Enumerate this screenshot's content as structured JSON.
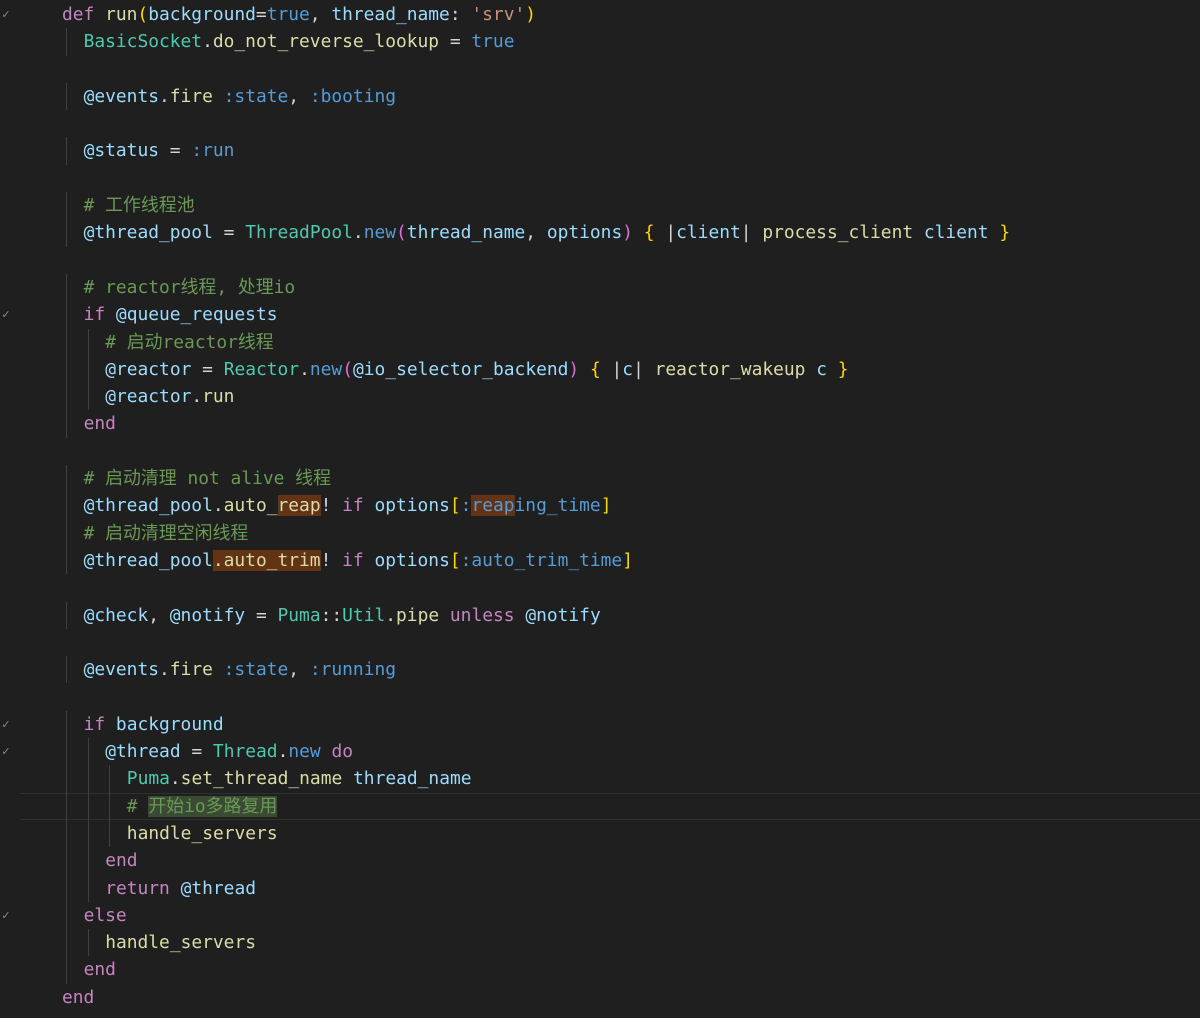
{
  "editor": {
    "gutter_markers": [
      {
        "line": 0,
        "symbol": "✓"
      },
      {
        "line": 11,
        "symbol": "✓"
      },
      {
        "line": 26,
        "symbol": "✓"
      },
      {
        "line": 27,
        "symbol": "✓"
      },
      {
        "line": 33,
        "symbol": "✓"
      }
    ],
    "current_line": 29,
    "lines": [
      {
        "indent": 0,
        "tokens": [
          [
            "def ",
            "kw"
          ],
          [
            "run",
            "fn"
          ],
          [
            "(",
            "br1"
          ],
          [
            "background",
            "var"
          ],
          [
            "=",
            "op"
          ],
          [
            "true",
            "bool"
          ],
          [
            ", ",
            "op"
          ],
          [
            "thread_name",
            "var"
          ],
          [
            ": ",
            "op"
          ],
          [
            "'srv'",
            "str"
          ],
          [
            ")",
            "br1"
          ]
        ]
      },
      {
        "indent": 1,
        "tokens": [
          [
            "BasicSocket",
            "cls"
          ],
          [
            ".",
            "op"
          ],
          [
            "do_not_reverse_lookup",
            "fn"
          ],
          [
            " = ",
            "op"
          ],
          [
            "true",
            "bool"
          ]
        ]
      },
      {
        "indent": 1,
        "tokens": []
      },
      {
        "indent": 1,
        "tokens": [
          [
            "@events",
            "ivar"
          ],
          [
            ".",
            "op"
          ],
          [
            "fire",
            "fn"
          ],
          [
            " ",
            "op"
          ],
          [
            ":state",
            "sym"
          ],
          [
            ", ",
            "op"
          ],
          [
            ":booting",
            "sym"
          ]
        ]
      },
      {
        "indent": 1,
        "tokens": []
      },
      {
        "indent": 1,
        "tokens": [
          [
            "@status",
            "ivar"
          ],
          [
            " = ",
            "op"
          ],
          [
            ":run",
            "sym"
          ]
        ]
      },
      {
        "indent": 1,
        "tokens": []
      },
      {
        "indent": 1,
        "tokens": [
          [
            "# 工作线程池",
            "cmt"
          ]
        ]
      },
      {
        "indent": 1,
        "tokens": [
          [
            "@thread_pool",
            "ivar"
          ],
          [
            " = ",
            "op"
          ],
          [
            "ThreadPool",
            "cls"
          ],
          [
            ".",
            "op"
          ],
          [
            "new",
            "bool"
          ],
          [
            "(",
            "br2"
          ],
          [
            "thread_name",
            "var"
          ],
          [
            ", ",
            "op"
          ],
          [
            "options",
            "var"
          ],
          [
            ")",
            "br2"
          ],
          [
            " ",
            "op"
          ],
          [
            "{",
            "br1"
          ],
          [
            " |",
            "op"
          ],
          [
            "client",
            "var"
          ],
          [
            "| ",
            "op"
          ],
          [
            "process_client",
            "fn"
          ],
          [
            " ",
            "op"
          ],
          [
            "client",
            "var"
          ],
          [
            " ",
            "op"
          ],
          [
            "}",
            "br1"
          ]
        ]
      },
      {
        "indent": 1,
        "tokens": []
      },
      {
        "indent": 1,
        "tokens": [
          [
            "# reactor线程, 处理io",
            "cmt"
          ]
        ]
      },
      {
        "indent": 1,
        "tokens": [
          [
            "if ",
            "kw"
          ],
          [
            "@queue_requests",
            "ivar"
          ]
        ]
      },
      {
        "indent": 2,
        "tokens": [
          [
            "# 启动reactor线程",
            "cmt"
          ]
        ]
      },
      {
        "indent": 2,
        "tokens": [
          [
            "@reactor",
            "ivar"
          ],
          [
            " = ",
            "op"
          ],
          [
            "Reactor",
            "cls"
          ],
          [
            ".",
            "op"
          ],
          [
            "new",
            "bool"
          ],
          [
            "(",
            "br2"
          ],
          [
            "@io_selector_backend",
            "ivar"
          ],
          [
            ")",
            "br2"
          ],
          [
            " ",
            "op"
          ],
          [
            "{",
            "br1"
          ],
          [
            " |",
            "op"
          ],
          [
            "c",
            "var"
          ],
          [
            "| ",
            "op"
          ],
          [
            "reactor_wakeup",
            "fn"
          ],
          [
            " ",
            "op"
          ],
          [
            "c",
            "var"
          ],
          [
            " ",
            "op"
          ],
          [
            "}",
            "br1"
          ]
        ]
      },
      {
        "indent": 2,
        "tokens": [
          [
            "@reactor",
            "ivar"
          ],
          [
            ".",
            "op"
          ],
          [
            "run",
            "fn"
          ]
        ]
      },
      {
        "indent": 1,
        "tokens": [
          [
            "end",
            "kw"
          ]
        ]
      },
      {
        "indent": 1,
        "tokens": []
      },
      {
        "indent": 1,
        "tokens": [
          [
            "# 启动清理 not alive 线程",
            "cmt"
          ]
        ]
      },
      {
        "indent": 1,
        "tokens": [
          [
            "@thread_pool",
            "ivar"
          ],
          [
            ".",
            "op"
          ],
          [
            "auto_",
            "fn"
          ],
          [
            "reap",
            "fn",
            "hl"
          ],
          [
            "! ",
            "op"
          ],
          [
            "if ",
            "kw"
          ],
          [
            "options",
            "var"
          ],
          [
            "[",
            "br1"
          ],
          [
            ":",
            "sym"
          ],
          [
            "reap",
            "sym",
            "hl"
          ],
          [
            "ing_time",
            "sym"
          ],
          [
            "]",
            "br1"
          ]
        ]
      },
      {
        "indent": 1,
        "tokens": [
          [
            "# 启动清理空闲线程",
            "cmt"
          ]
        ]
      },
      {
        "indent": 1,
        "tokens": [
          [
            "@thread_pool",
            "ivar"
          ],
          [
            ".auto_trim",
            "fn",
            "hl"
          ],
          [
            "! ",
            "op"
          ],
          [
            "if ",
            "kw"
          ],
          [
            "options",
            "var"
          ],
          [
            "[",
            "br1"
          ],
          [
            ":auto_trim_time",
            "sym"
          ],
          [
            "]",
            "br1"
          ]
        ]
      },
      {
        "indent": 1,
        "tokens": []
      },
      {
        "indent": 1,
        "tokens": [
          [
            "@check",
            "ivar"
          ],
          [
            ", ",
            "op"
          ],
          [
            "@notify",
            "ivar"
          ],
          [
            " = ",
            "op"
          ],
          [
            "Puma",
            "cls"
          ],
          [
            "::",
            "op"
          ],
          [
            "Util",
            "cls"
          ],
          [
            ".",
            "op"
          ],
          [
            "pipe",
            "fn"
          ],
          [
            " ",
            "op"
          ],
          [
            "unless ",
            "kw"
          ],
          [
            "@notify",
            "ivar"
          ]
        ]
      },
      {
        "indent": 1,
        "tokens": []
      },
      {
        "indent": 1,
        "tokens": [
          [
            "@events",
            "ivar"
          ],
          [
            ".",
            "op"
          ],
          [
            "fire",
            "fn"
          ],
          [
            " ",
            "op"
          ],
          [
            ":state",
            "sym"
          ],
          [
            ", ",
            "op"
          ],
          [
            ":running",
            "sym"
          ]
        ]
      },
      {
        "indent": 1,
        "tokens": []
      },
      {
        "indent": 1,
        "tokens": [
          [
            "if ",
            "kw"
          ],
          [
            "background",
            "var"
          ]
        ]
      },
      {
        "indent": 2,
        "tokens": [
          [
            "@thread",
            "ivar"
          ],
          [
            " = ",
            "op"
          ],
          [
            "Thread",
            "cls"
          ],
          [
            ".",
            "op"
          ],
          [
            "new",
            "bool"
          ],
          [
            " ",
            "op"
          ],
          [
            "do",
            "kw"
          ]
        ]
      },
      {
        "indent": 3,
        "tokens": [
          [
            "Puma",
            "cls"
          ],
          [
            ".",
            "op"
          ],
          [
            "set_thread_name",
            "fn"
          ],
          [
            " ",
            "op"
          ],
          [
            "thread_name",
            "var"
          ]
        ]
      },
      {
        "indent": 3,
        "tokens": [
          [
            "# ",
            "cmt"
          ],
          [
            "开始io多路复用",
            "cmt",
            "sel"
          ]
        ]
      },
      {
        "indent": 3,
        "tokens": [
          [
            "handle_servers",
            "fn"
          ]
        ]
      },
      {
        "indent": 2,
        "tokens": [
          [
            "end",
            "kw"
          ]
        ]
      },
      {
        "indent": 2,
        "tokens": [
          [
            "return ",
            "kw"
          ],
          [
            "@thread",
            "ivar"
          ]
        ]
      },
      {
        "indent": 1,
        "tokens": [
          [
            "else",
            "kw"
          ]
        ]
      },
      {
        "indent": 2,
        "tokens": [
          [
            "handle_servers",
            "fn"
          ]
        ]
      },
      {
        "indent": 1,
        "tokens": [
          [
            "end",
            "kw"
          ]
        ]
      },
      {
        "indent": 0,
        "tokens": [
          [
            "end",
            "kw"
          ]
        ]
      }
    ]
  }
}
